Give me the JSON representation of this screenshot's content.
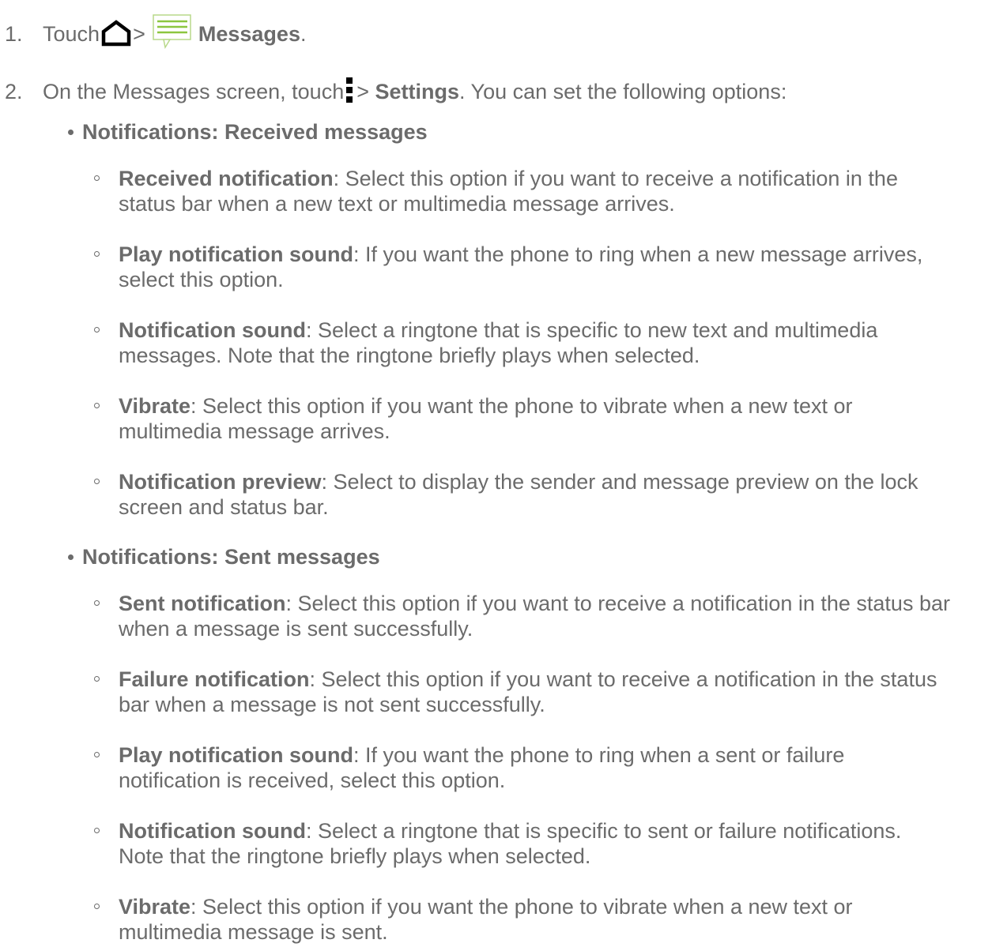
{
  "steps": [
    {
      "number": "1.",
      "before": "Touch",
      "sep": ">",
      "target": "Messages",
      "end": "."
    },
    {
      "number": "2.",
      "before": "On the Messages screen, touch",
      "sep": ">",
      "target": "Settings",
      "after": ". You can set the following options:"
    }
  ],
  "sections": [
    {
      "heading": "Notifications: Received messages",
      "items": [
        {
          "term": "Received notification",
          "line1": ": Select this option if you want to receive a notification in the",
          "line2": "status bar when a new text or multimedia message arrives."
        },
        {
          "term": "Play notification sound",
          "line1": ": If you want the phone to ring when a new message arrives,",
          "line2": "select this option."
        },
        {
          "term": "Notification sound",
          "line1": ": Select a ringtone that is specific to new text and multimedia",
          "line2": "messages. Note that the ringtone briefly plays when selected."
        },
        {
          "term": "Vibrate",
          "line1": ": Select this option if you want the phone to vibrate when a new text or",
          "line2": "multimedia message arrives."
        },
        {
          "term": "Notification preview",
          "line1": ": Select to display the sender and message preview on the lock",
          "line2": "screen and status bar."
        }
      ]
    },
    {
      "heading": "Notifications: Sent messages",
      "items": [
        {
          "term": "Sent notification",
          "line1": ": Select this option if you want to receive a notification in the status bar",
          "line2": "when a message is sent successfully."
        },
        {
          "term": "Failure notification",
          "line1": ": Select this option if you want to receive a notification in the status",
          "line2": "bar when a message is not sent successfully."
        },
        {
          "term": "Play notification sound",
          "line1": ": If you want the phone to ring when a sent or failure",
          "line2": "notification is received, select this option."
        },
        {
          "term": "Notification sound",
          "line1": ": Select a ringtone that is specific to sent or failure notifications.",
          "line2": "Note that the ringtone briefly plays when selected."
        },
        {
          "term": "Vibrate",
          "line1": ": Select this option if you want the phone to vibrate when a new text or",
          "line2": "multimedia message is sent."
        }
      ]
    }
  ],
  "icons": {
    "home": "home-icon",
    "messages": "messages-icon",
    "menu": "menu-icon"
  },
  "colors": {
    "text": "#6b6b6b",
    "messages_icon_green": "#8cc63f"
  }
}
